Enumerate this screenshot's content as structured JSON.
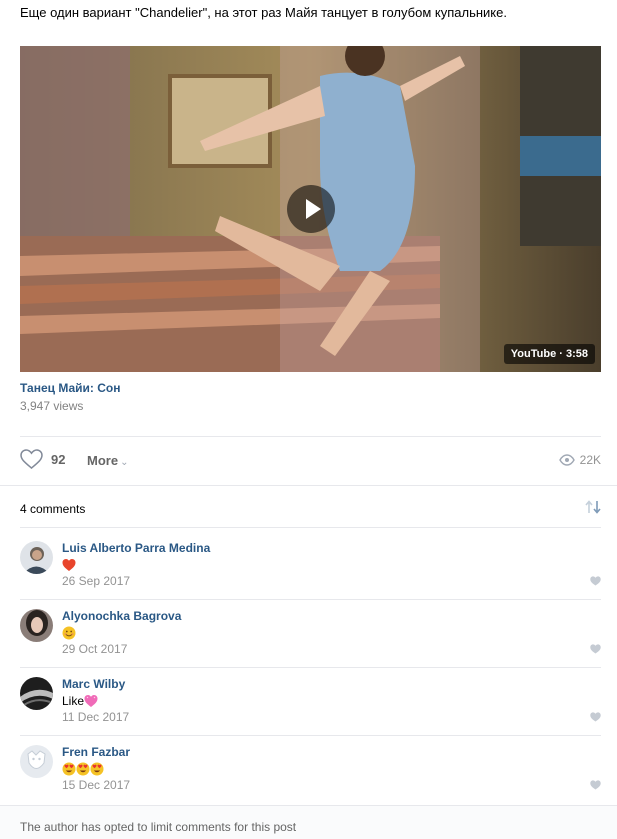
{
  "post": {
    "text": "Еще один вариант \"Chandelier\", на этот раз Майя танцует в голубом купальнике."
  },
  "video": {
    "source": "YouTube",
    "duration": "3:58",
    "badge": "YouTube · 3:58",
    "title": "Танец Майи: Сон",
    "views": "3,947 views"
  },
  "actions": {
    "like_count": "92",
    "more_label": "More",
    "views_count": "22K"
  },
  "comments": {
    "header": "4 comments",
    "items": [
      {
        "author": "Luis Alberto Parra Medina",
        "text": "",
        "emoji": [
          "heart"
        ],
        "date": "26 Sep 2017"
      },
      {
        "author": "Alyonochka Bagrova",
        "text": "",
        "emoji": [
          "smile"
        ],
        "date": "29 Oct 2017"
      },
      {
        "author": "Marc Wilby",
        "text": "Like",
        "emoji": [
          "pink-heart"
        ],
        "date": "11 Dec 2017"
      },
      {
        "author": "Fren Fazbar",
        "text": "",
        "emoji": [
          "heart-eyes",
          "heart-eyes",
          "heart-eyes"
        ],
        "date": "15 Dec 2017"
      }
    ]
  },
  "footer": {
    "note": "The author has opted to limit comments for this post"
  },
  "colors": {
    "link": "#2a5885",
    "muted": "#939393",
    "divider": "#e7e8ec"
  }
}
